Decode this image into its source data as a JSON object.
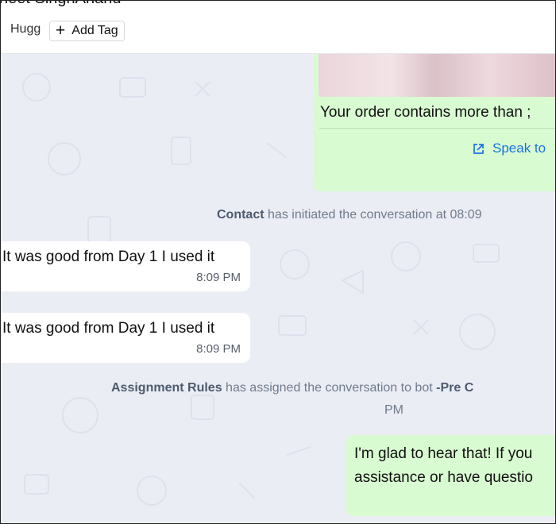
{
  "header": {
    "contact_name": "neet SinghAnand",
    "tag": "Hugg",
    "add_tag_label": "Add Tag"
  },
  "messages": [
    {
      "type": "outgoing",
      "text": "Your order contains more than ;",
      "cta": "Speak to"
    },
    {
      "type": "system",
      "actor": "Contact",
      "text": "has initiated the conversation at 08:09"
    },
    {
      "type": "incoming",
      "text": "It was good from Day 1 I used it",
      "time": "8:09 PM"
    },
    {
      "type": "incoming",
      "text": "It was good from Day 1 I used it",
      "time": "8:09 PM"
    },
    {
      "type": "system",
      "actor": "Assignment Rules",
      "text": "has assigned the conversation to bot",
      "suffix": "-Pre C",
      "line2": "PM"
    },
    {
      "type": "outgoing",
      "text": "I'm glad to hear that! If you\nassistance or have questio"
    }
  ],
  "icons": {
    "add": "plus-icon",
    "cta": "external-link-icon"
  },
  "colors": {
    "chat_bg": "#ebedf5",
    "outgoing": "#d9fbd1",
    "incoming": "#ffffff",
    "link": "#1a73e8"
  }
}
